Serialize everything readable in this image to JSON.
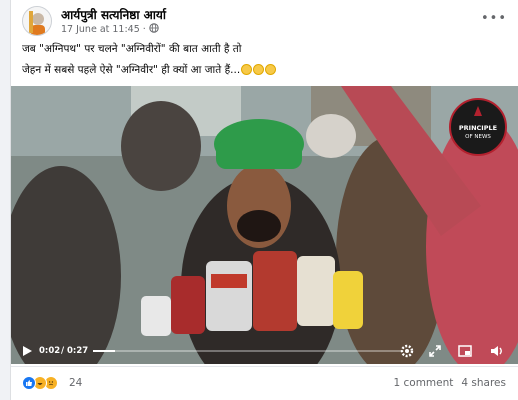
{
  "post": {
    "author": "आर्यपुत्री सत्यनिष्ठा आर्या",
    "timestamp": "17 June at 11:45",
    "separator": "·",
    "audience_icon": "globe-icon",
    "text_line1": "जब \"अग्निपथ\" पर चलने \"अग्निवीरों\" की बात आती है तो",
    "text_line2": "जेहन में सबसे पहले ऐसे \"अग्निवीर\" ही क्यों आ जाते हैं..."
  },
  "video": {
    "current_time": "0:02",
    "time_separator": "/",
    "duration": "0:27",
    "progress_fraction": 0.07,
    "watermark_line1": "PRINCIPLE",
    "watermark_line2": "OF NEWS",
    "controls": [
      "play-icon",
      "settings-icon",
      "expand-icon",
      "pip-icon",
      "volume-icon"
    ]
  },
  "reactions": {
    "count": "24",
    "icons": [
      "like-icon",
      "haha-icon",
      "sad-icon"
    ]
  },
  "stats": {
    "comments": "1 comment",
    "shares": "4 shares"
  },
  "colors": {
    "accent": "#1877f2",
    "secondary_text": "#65676b",
    "turban_green": "#2e9b4a",
    "watermark_red": "#b3212e"
  }
}
